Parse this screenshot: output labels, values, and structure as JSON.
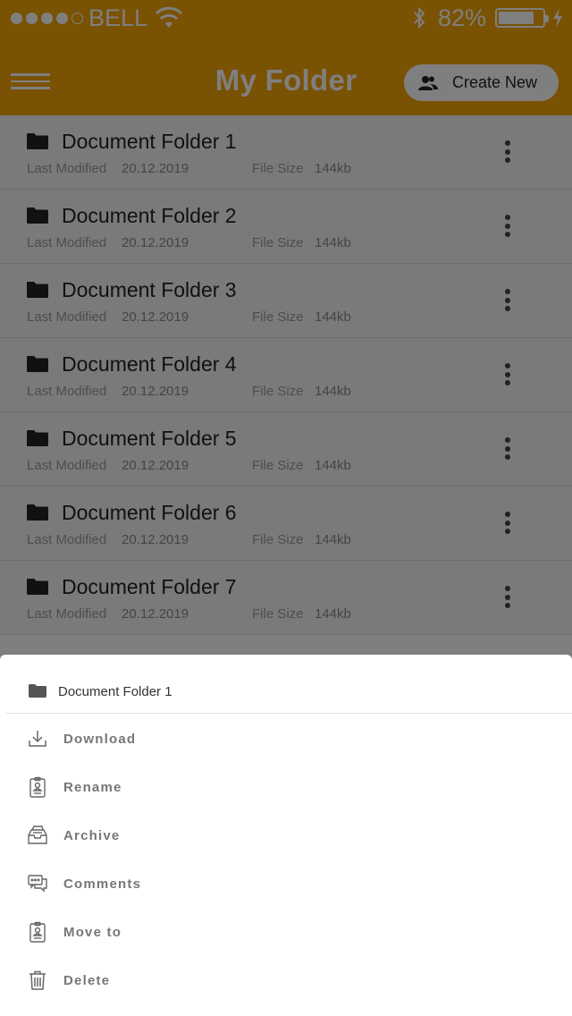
{
  "status_bar": {
    "carrier": "BELL",
    "battery_percent": "82%",
    "battery_level": 0.82,
    "signal_bars_filled": 4,
    "signal_bars_total": 5
  },
  "header": {
    "title": "My Folder",
    "create_button_label": "Create New",
    "background_color": "#f5a406"
  },
  "labels": {
    "last_modified": "Last Modified",
    "file_size": "File Size"
  },
  "folders": [
    {
      "name": "Document Folder 1",
      "modified": "20.12.2019",
      "size": "144kb"
    },
    {
      "name": "Document Folder 2",
      "modified": "20.12.2019",
      "size": "144kb"
    },
    {
      "name": "Document Folder 3",
      "modified": "20.12.2019",
      "size": "144kb"
    },
    {
      "name": "Document Folder 4",
      "modified": "20.12.2019",
      "size": "144kb"
    },
    {
      "name": "Document Folder 5",
      "modified": "20.12.2019",
      "size": "144kb"
    },
    {
      "name": "Document Folder 6",
      "modified": "20.12.2019",
      "size": "144kb"
    },
    {
      "name": "Document Folder 7",
      "modified": "20.12.2019",
      "size": "144kb"
    }
  ],
  "action_sheet": {
    "title": "Document Folder 1",
    "actions": [
      {
        "label": "Download",
        "icon": "download-icon"
      },
      {
        "label": "Rename",
        "icon": "clipboard-user-icon"
      },
      {
        "label": "Archive",
        "icon": "archive-icon"
      },
      {
        "label": "Comments",
        "icon": "comments-icon"
      },
      {
        "label": "Move to",
        "icon": "clipboard-user-icon"
      },
      {
        "label": "Delete",
        "icon": "trash-icon"
      }
    ]
  }
}
